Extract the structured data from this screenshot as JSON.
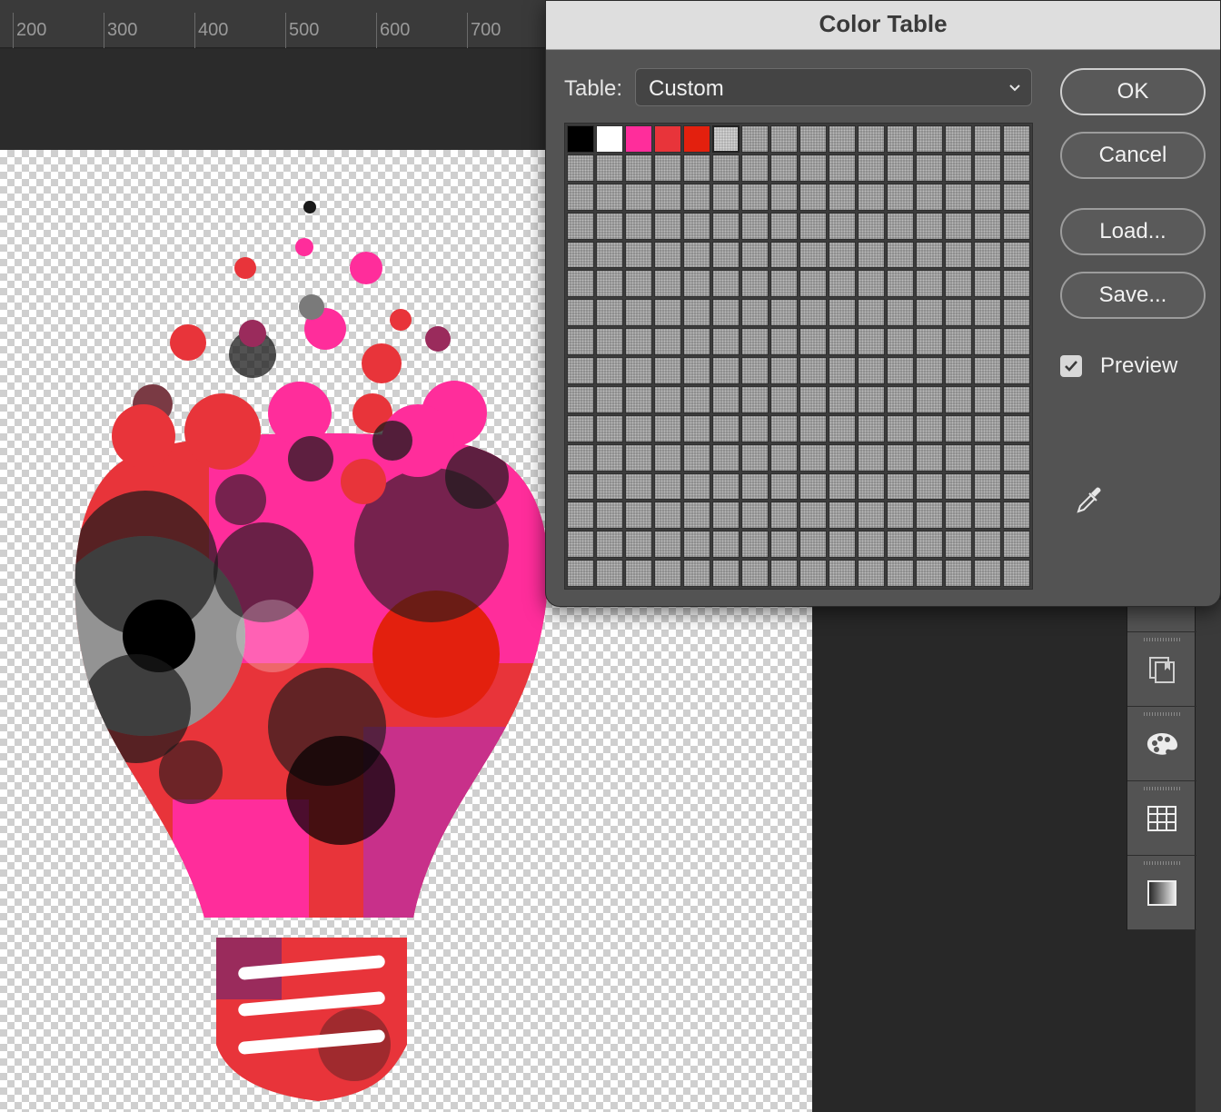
{
  "ruler": {
    "labels": [
      "200",
      "300",
      "400",
      "500",
      "600",
      "700"
    ]
  },
  "dialog": {
    "title": "Color Table",
    "table_label": "Table:",
    "table_value": "Custom",
    "buttons": {
      "ok": "OK",
      "cancel": "Cancel",
      "load": "Load...",
      "save": "Save..."
    },
    "preview_label": "Preview",
    "preview_checked": true,
    "swatch_colors": [
      "#000000",
      "#ffffff",
      "#ff2d9b",
      "#e8343a",
      "#e3200e"
    ],
    "transparent_swatch": true,
    "grid": {
      "rows": 16,
      "cols": 16
    },
    "eyedropper_icon": "eyedropper-icon"
  },
  "panel_icons": [
    "history-icon",
    "artboards-icon",
    "color-palette-icon",
    "table-icon",
    "gradient-icon"
  ]
}
